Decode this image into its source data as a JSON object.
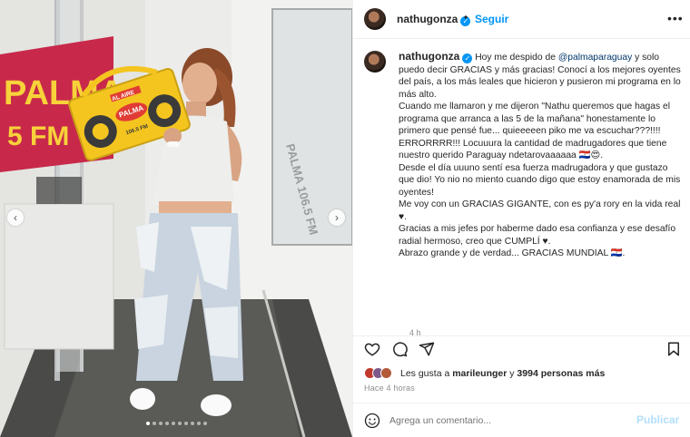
{
  "header": {
    "username": "nathugonza",
    "separator": "•",
    "follow_label": "Seguir",
    "more_icon": "more-horizontal-icon"
  },
  "photo": {
    "radio_sign_text": "PALMA",
    "radio_sign_sub": "5 FM",
    "boombox_top": "AL AIRE",
    "boombox_brand": "PALMA",
    "boombox_freq": "106.5 FM",
    "wall_sign": "PALMA 106.5 FM",
    "prev_icon": "chevron-left-icon",
    "next_icon": "chevron-right-icon",
    "carousel_total": 10,
    "carousel_active": 0
  },
  "caption": {
    "username": "nathugonza",
    "part1": "Hoy me despido de",
    "mention": "@palmaparaguay",
    "part2": "y solo puedo decir GRACIAS y más gracias! Conocí a los mejores oyentes del país, a los más leales que hicieron y pusieron mi programa en lo más alto.",
    "p2": "Cuando me llamaron y me dijeron \"Nathu queremos que hagas el programa que arranca a las 5 de la mañana\" honestamente lo primero que pensé fue... quieeeeen piko me va escuchar???!!!!",
    "p3": "ERRORRRR!!! Locuuura la cantidad de madrugadores que tiene nuestro querido Paraguay ndetarovaaaaaa 🇵🇾😍.",
    "p4": "Desde el día uuuno sentí esa fuerza madrugadora y que gustazo que dio! Yo nio no miento cuando digo que estoy enamorada de mis oyentes!",
    "p5": "Me voy con un GRACIAS GIGANTE, con es py'a rory en la vida real ♥.",
    "p6": "Gracias a mis jefes por haberme dado esa confianza y ese desafío radial hermoso, creo que CUMPLÍ ♥.",
    "p7": "Abrazo grande y de verdad... GRACIAS MUNDIAL 🇵🇾.",
    "time": "4 h"
  },
  "actions": {
    "like_icon": "heart-icon",
    "comment_icon": "comment-icon",
    "share_icon": "share-icon",
    "save_icon": "bookmark-icon"
  },
  "likes": {
    "prefix": "Les gusta a",
    "user": "marileunger",
    "middle": "y",
    "count": "3994 personas más"
  },
  "posted": "Hace 4 horas",
  "comment": {
    "emoji_icon": "emoji-icon",
    "placeholder": "Agrega un comentario...",
    "publish_label": "Publicar"
  }
}
